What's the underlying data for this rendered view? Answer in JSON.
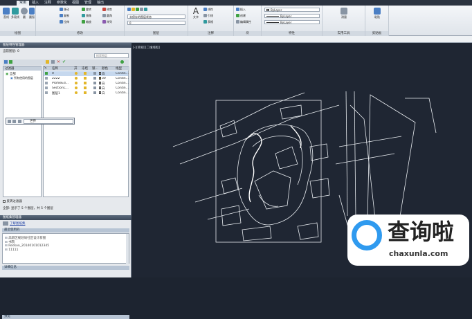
{
  "ribbon": {
    "tabs": [
      "常用",
      "插入",
      "注释",
      "参数化",
      "视图",
      "管理",
      "输出"
    ],
    "active_tab": 0,
    "panels": [
      {
        "title": "绘图",
        "buttons": [
          "直线",
          "多段线",
          "圆",
          "圆弧"
        ]
      },
      {
        "title": "修改",
        "buttons": [
          "移动",
          "旋转",
          "修剪",
          "复制",
          "镜像",
          "圆角",
          "拉伸",
          "缩放",
          "阵列"
        ]
      },
      {
        "title": "图层",
        "state_label": "未保存的图层状态",
        "layer_value": "0"
      },
      {
        "title": "注释",
        "buttons": [
          "文字",
          "线性",
          "引线",
          "表格"
        ]
      },
      {
        "title": "块",
        "buttons": [
          "插入",
          "创建",
          "编辑",
          "编辑属性"
        ]
      },
      {
        "title": "特性",
        "bylayer_1": "ByLayer",
        "bylayer_2": "ByLayer",
        "bylayer_3": "ByLayer"
      },
      {
        "title": "实用工具",
        "buttons": [
          "测量"
        ]
      },
      {
        "title": "剪贴板",
        "buttons": [
          "粘贴"
        ]
      }
    ]
  },
  "layer_manager": {
    "title": "图层特性管理器",
    "current_layer": "当前图层: 0",
    "search_placeholder": "搜索图层",
    "filter_label": "过滤器",
    "filter_all": "全部",
    "filter_used": "所有使用的图层",
    "columns": [
      "S.",
      "名称",
      "开",
      "冻结",
      "锁...",
      "颜色",
      "线型"
    ],
    "rows": [
      {
        "name": "0",
        "color": "白",
        "linetype": "Contin..."
      },
      {
        "name": "2222",
        "color": "30",
        "linetype": "Contin..."
      },
      {
        "name": "ProfileEd...",
        "color": "白",
        "linetype": "Contin..."
      },
      {
        "name": "SectionC...",
        "color": "白",
        "linetype": "Contin..."
      },
      {
        "name": "图层1",
        "color": "白",
        "linetype": "Contin..."
      }
    ],
    "invert_filter": "反转过滤器",
    "status": "全部: 显示了 5 个图层，共 5 个图层",
    "popup_value": "世界"
  },
  "sheet_manager": {
    "title": "图纸集管理器",
    "link": "了解图纸集",
    "section1": "最近使用的",
    "items": [
      "高新区规划局社区设计新图",
      "书院",
      "Redson_20140101012345",
      "11111"
    ],
    "section2": "详细信息",
    "section3": "预览"
  },
  "viewport": {
    "label": "[-][俯视][二维线框]"
  },
  "watermark": {
    "text": "查询啦",
    "url": "chaxunla.com"
  },
  "colors": {
    "ribbon_accent": "#4b7fc4",
    "viewport_bg": "#1f2633",
    "drawing": "#e8ecf0"
  }
}
